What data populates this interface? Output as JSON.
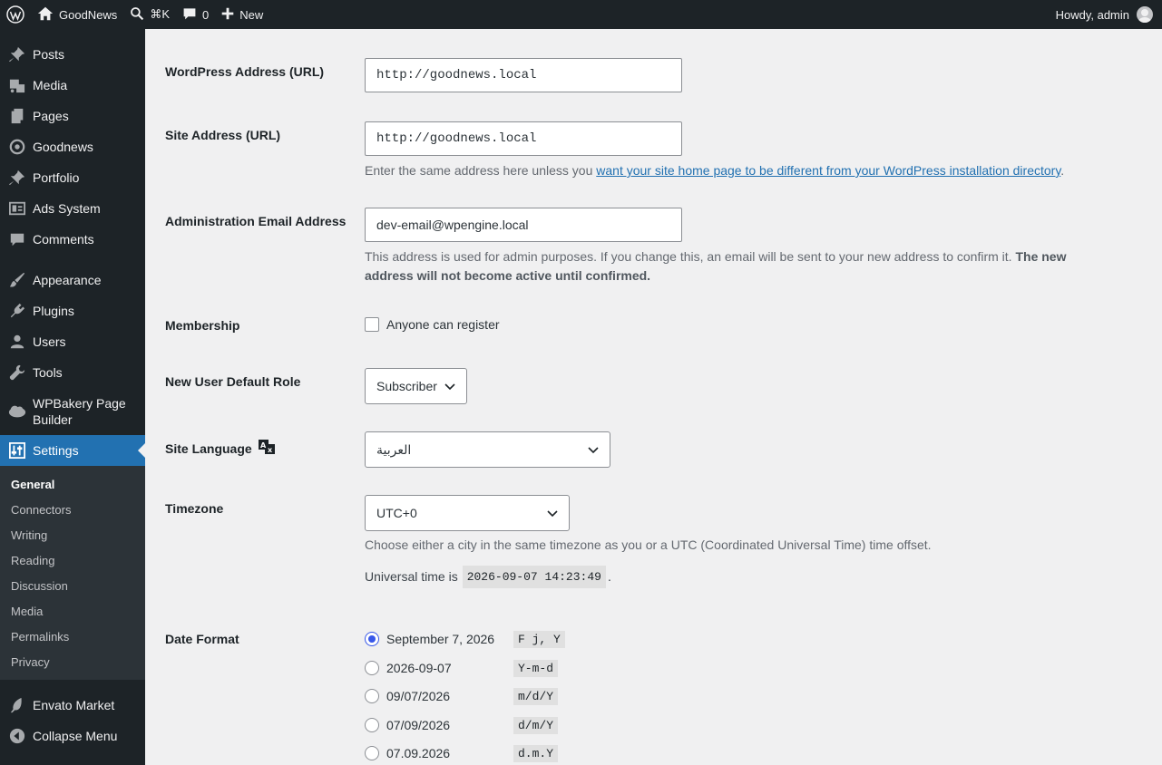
{
  "adminbar": {
    "site_name": "GoodNews",
    "search_shortcut": "⌘K",
    "comments_count": "0",
    "new_label": "New",
    "howdy": "Howdy, admin"
  },
  "sidebar": {
    "items": [
      {
        "label": "Posts"
      },
      {
        "label": "Media"
      },
      {
        "label": "Pages"
      },
      {
        "label": "Goodnews"
      },
      {
        "label": "Portfolio"
      },
      {
        "label": "Ads System"
      },
      {
        "label": "Comments"
      },
      {
        "label": "Appearance"
      },
      {
        "label": "Plugins"
      },
      {
        "label": "Users"
      },
      {
        "label": "Tools"
      },
      {
        "label": "WPBakery Page Builder"
      },
      {
        "label": "Settings"
      },
      {
        "label": "Envato Market"
      },
      {
        "label": "Collapse Menu"
      }
    ],
    "submenu": [
      "General",
      "Connectors",
      "Writing",
      "Reading",
      "Discussion",
      "Media",
      "Permalinks",
      "Privacy"
    ]
  },
  "form": {
    "wp_address": {
      "label": "WordPress Address (URL)",
      "value": "http://goodnews.local"
    },
    "site_address": {
      "label": "Site Address (URL)",
      "value": "http://goodnews.local",
      "desc_prefix": "Enter the same address here unless you ",
      "desc_link": "want your site home page to be different from your WordPress installation directory",
      "desc_suffix": "."
    },
    "admin_email": {
      "label": "Administration Email Address",
      "value": "dev-email@wpengine.local",
      "desc_normal": "This address is used for admin purposes. If you change this, an email will be sent to your new address to confirm it. ",
      "desc_bold": "The new address will not become active until confirmed."
    },
    "membership": {
      "label": "Membership",
      "checkbox_label": "Anyone can register"
    },
    "default_role": {
      "label": "New User Default Role",
      "value": "Subscriber"
    },
    "site_language": {
      "label": "Site Language",
      "value": "العربية"
    },
    "timezone": {
      "label": "Timezone",
      "value": "UTC+0",
      "desc": "Choose either a city in the same timezone as you or a UTC (Coordinated Universal Time) time offset.",
      "universal_prefix": "Universal time is",
      "universal_time": "2026-09-07 14:23:49",
      "universal_suffix": "."
    },
    "date_format": {
      "label": "Date Format",
      "options": [
        {
          "text": "September 7, 2026",
          "code": "F j, Y"
        },
        {
          "text": "2026-09-07",
          "code": "Y-m-d"
        },
        {
          "text": "09/07/2026",
          "code": "m/d/Y"
        },
        {
          "text": "07/09/2026",
          "code": "d/m/Y"
        },
        {
          "text": "07.09.2026",
          "code": "d.m.Y"
        }
      ]
    }
  },
  "colors": {
    "adminbar_bg": "#1d2327",
    "accent": "#2271b1",
    "radio_checked": "#3858e9"
  }
}
